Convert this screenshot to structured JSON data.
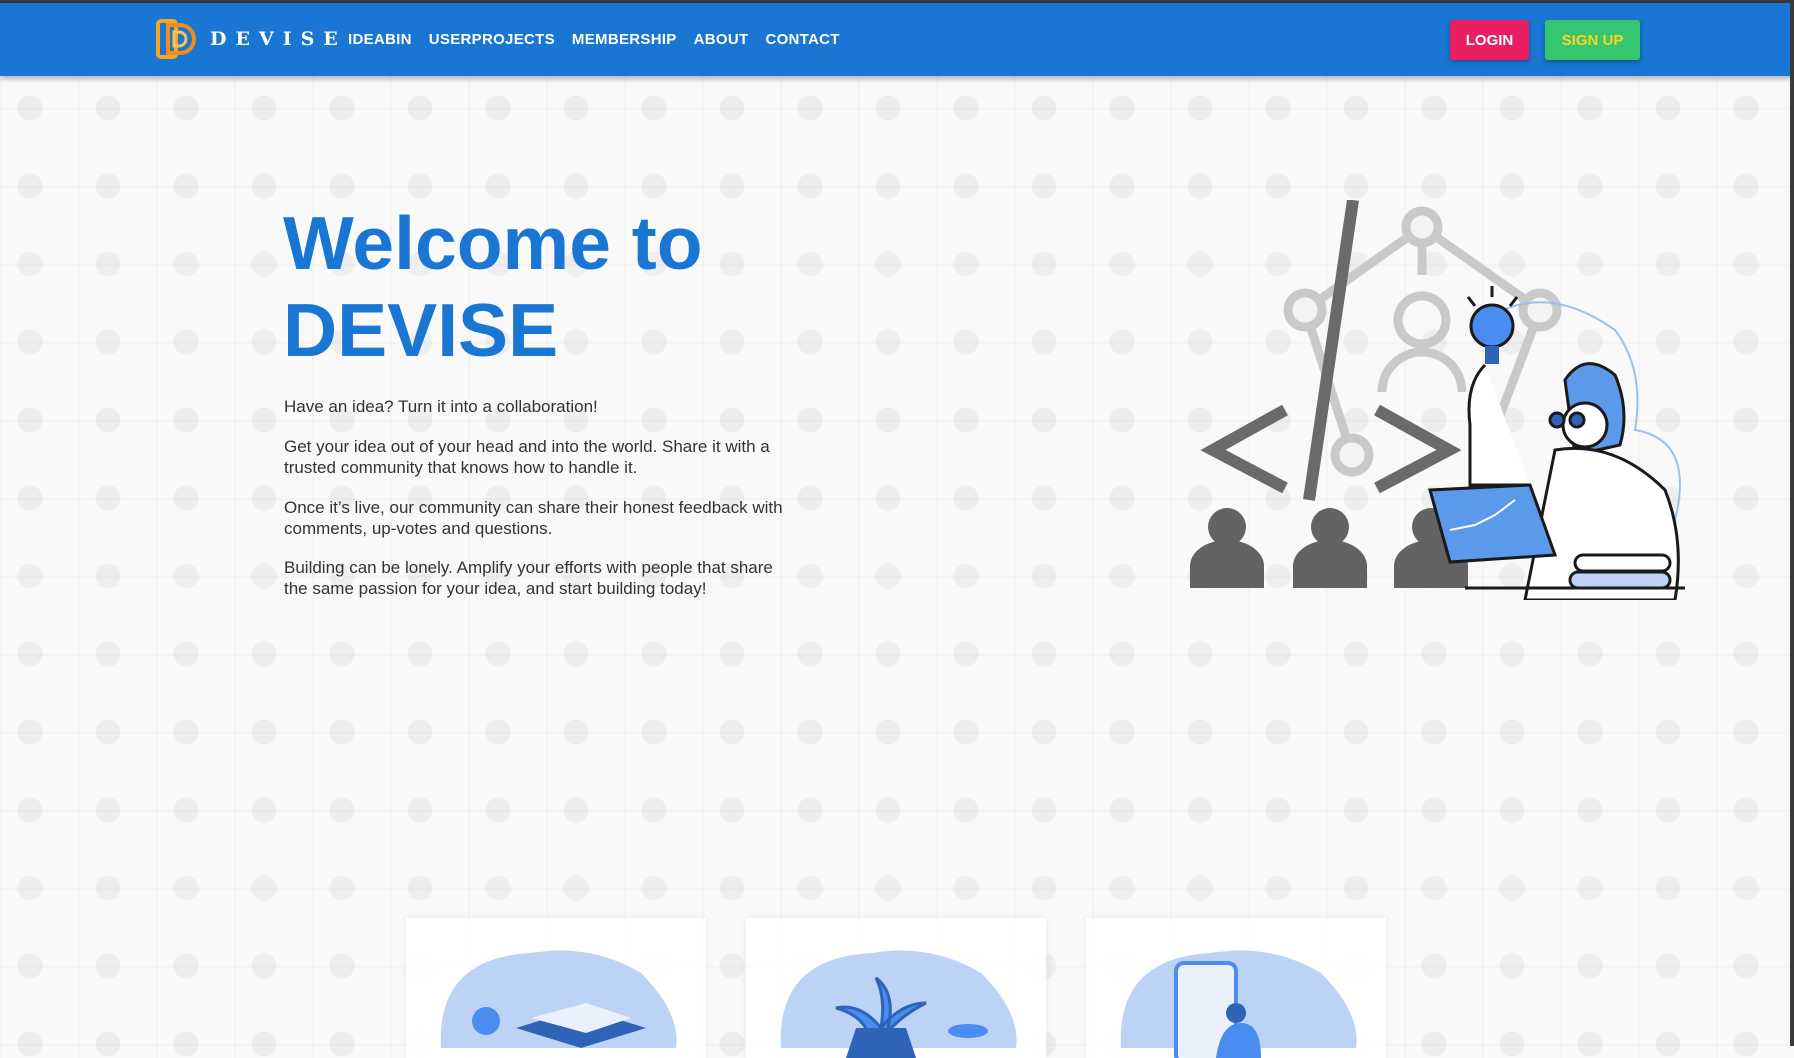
{
  "brand": {
    "name": "DEVISE",
    "logo_icon": "devise-logo-icon"
  },
  "nav": {
    "links": [
      "IDEABIN",
      "USERPROJECTS",
      "MEMBERSHIP",
      "ABOUT",
      "CONTACT"
    ],
    "login_label": "LOGIN",
    "signup_label": "SIGN UP"
  },
  "hero": {
    "title_line1": "Welcome to",
    "title_line2": "DEVISE",
    "paragraphs": [
      "Have an idea? Turn it into a collaboration!",
      "Get your idea out of your head and into the world. Share it with a trusted community that knows how to handle it.",
      "Once it’s live, our community can share their honest feedback with comments, up-votes and questions.",
      "Building can be lonely. Amplify your efforts with people that share the same passion for your idea, and start building today!"
    ]
  },
  "colors": {
    "navbar": "#1976d2",
    "login": "#e91e63",
    "signup": "#35c66f",
    "title": "#1976d2",
    "accent_light": "#bcd3f5"
  }
}
